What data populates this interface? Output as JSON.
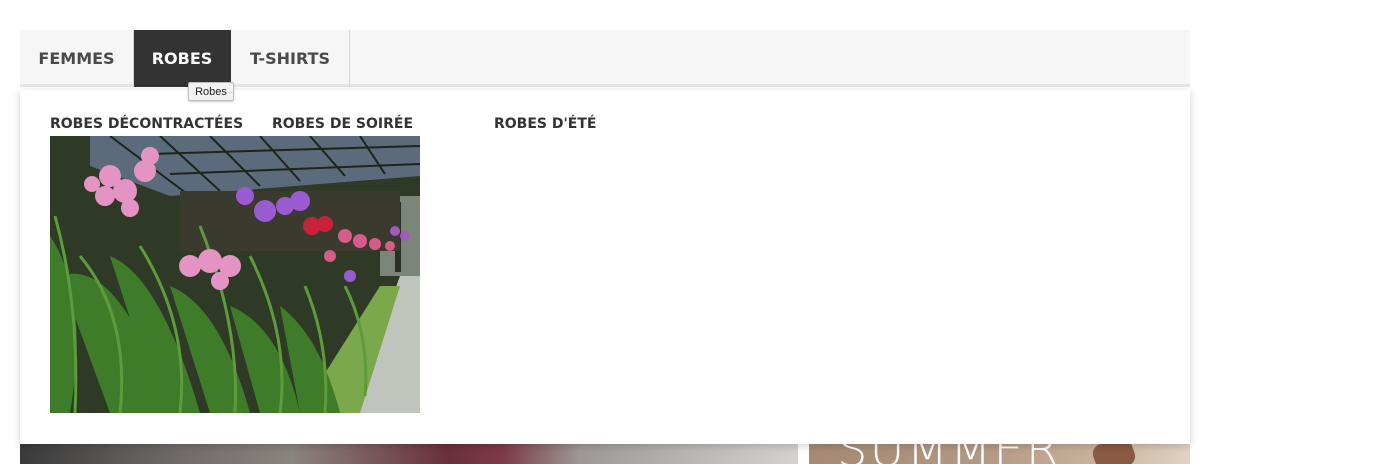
{
  "nav": {
    "items": [
      {
        "label": "FEMMES",
        "active": false
      },
      {
        "label": "ROBES",
        "active": true
      },
      {
        "label": "T-SHIRTS",
        "active": false
      }
    ],
    "tooltip": "Robes"
  },
  "dropdown": {
    "links": [
      {
        "label": "ROBES DÉCONTRACTÉES"
      },
      {
        "label": "ROBES DE SOIRÉE"
      },
      {
        "label": "ROBES D'ÉTÉ"
      }
    ],
    "image_subject": "orchids-greenhouse-photo"
  },
  "banner": {
    "right_text": "SUMMER"
  },
  "colors": {
    "nav_bg": "#f6f6f6",
    "active_bg": "#333333",
    "text": "#333333"
  }
}
